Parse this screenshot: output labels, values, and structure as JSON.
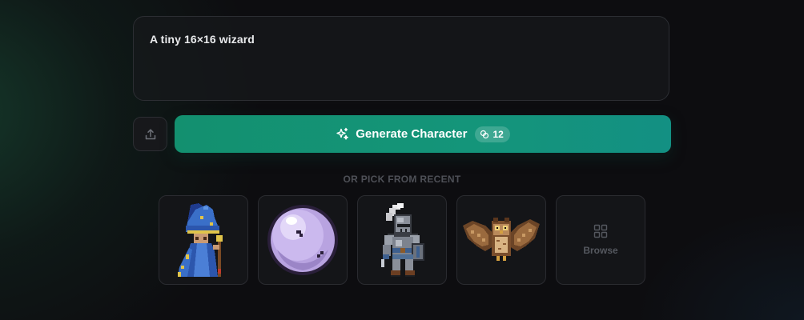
{
  "prompt": {
    "text": "A tiny 16×16 wizard"
  },
  "actions": {
    "upload_icon": "upload-icon",
    "generate_label": "Generate Character",
    "generate_icon": "sparkle-icon",
    "credit_icon": "coin-icon",
    "credit_count": "12",
    "accent_color": "#13906f"
  },
  "recent": {
    "heading": "OR PICK FROM RECENT",
    "items": [
      {
        "name": "wizard",
        "icon": "wizard-sprite"
      },
      {
        "name": "orb",
        "icon": "orb-sprite"
      },
      {
        "name": "knight",
        "icon": "knight-sprite"
      },
      {
        "name": "owl",
        "icon": "owl-sprite"
      }
    ],
    "browse_label": "Browse",
    "browse_icon": "grid-icon"
  }
}
